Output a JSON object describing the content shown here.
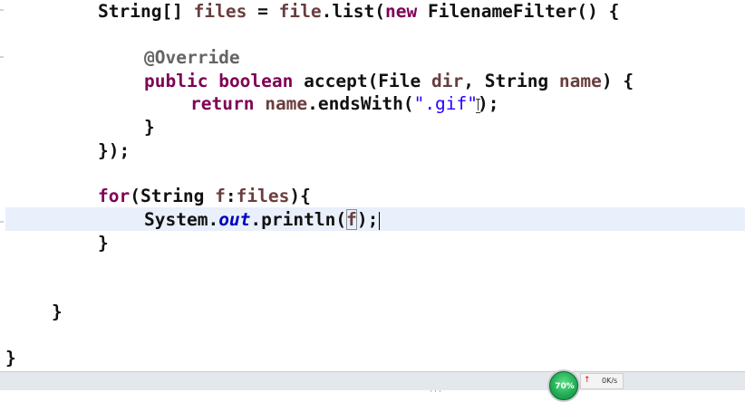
{
  "editor": {
    "line1": {
      "t1": "String[] ",
      "t2": "files",
      "t3": " = ",
      "t4": "file",
      "t5": ".list(",
      "t6": "new",
      "t7": " FilenameFilter() {"
    },
    "line2": {
      "ann": "@Override"
    },
    "line3": {
      "kw1": "public",
      "kw2": "boolean",
      "t1": " accept(File ",
      "v1": "dir",
      "t2": ", String ",
      "v2": "name",
      "t3": ") {"
    },
    "line4": {
      "kw": "return",
      "v": "name",
      "t1": ".endsWith(",
      "str": "\".gif\"",
      "t2": ");"
    },
    "line5": {
      "t": "}"
    },
    "line6": {
      "t": "});"
    },
    "line7": {
      "kw": "for",
      "t1": "(String ",
      "v1": "f",
      "t2": ":",
      "v2": "files",
      "t3": "){"
    },
    "line8": {
      "t1": "System.",
      "field": "out",
      "t2": ".println(",
      "v": "f",
      "t3": ");"
    },
    "line9": {
      "t": "}"
    },
    "line10": {
      "t": "}"
    },
    "line11": {
      "t": "}"
    }
  },
  "statusbar": {
    "gauge_percent": "70%",
    "net_speed": "0K/s",
    "up_arrow": "↑",
    "dots": "· · ·"
  },
  "colors": {
    "keyword": "#7f0055",
    "variable": "#6a3e3e",
    "annotation": "#646464",
    "string": "#2a00ff",
    "static_field": "#0000c0",
    "current_line": "#e9f0fb",
    "gauge_green": "#1faa52"
  }
}
